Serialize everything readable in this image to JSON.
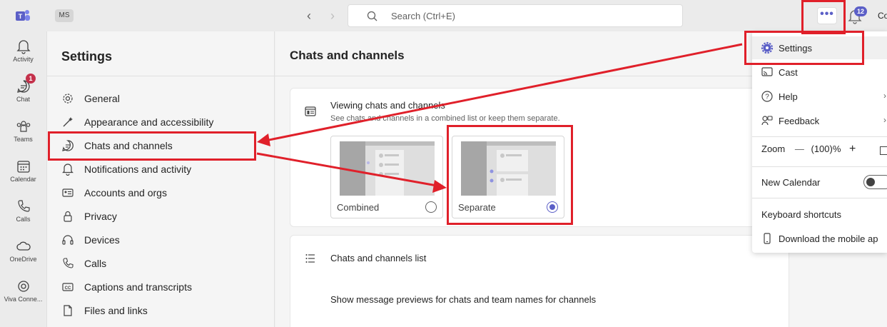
{
  "titlebar": {
    "user_initials": "MS",
    "search_placeholder": "Search (Ctrl+E)",
    "notification_count": "12",
    "profile_text": "Co",
    "more_label": "•••"
  },
  "rail": [
    {
      "label": "Activity",
      "icon": "bell-icon"
    },
    {
      "label": "Chat",
      "icon": "chat-icon",
      "badge": "1"
    },
    {
      "label": "Teams",
      "icon": "teams-icon"
    },
    {
      "label": "Calendar",
      "icon": "calendar-icon"
    },
    {
      "label": "Calls",
      "icon": "phone-icon"
    },
    {
      "label": "OneDrive",
      "icon": "cloud-icon"
    },
    {
      "label": "Viva Conne...",
      "icon": "viva-icon"
    }
  ],
  "settings": {
    "title": "Settings",
    "items": [
      {
        "label": "General",
        "icon": "gear-icon"
      },
      {
        "label": "Appearance and accessibility",
        "icon": "wand-icon"
      },
      {
        "label": "Chats and channels",
        "icon": "chat-bubble-icon"
      },
      {
        "label": "Notifications and activity",
        "icon": "bell-icon"
      },
      {
        "label": "Accounts and orgs",
        "icon": "id-card-icon"
      },
      {
        "label": "Privacy",
        "icon": "lock-icon"
      },
      {
        "label": "Devices",
        "icon": "headset-icon"
      },
      {
        "label": "Calls",
        "icon": "phone-icon"
      },
      {
        "label": "Captions and transcripts",
        "icon": "cc-icon"
      },
      {
        "label": "Files and links",
        "icon": "file-icon"
      }
    ]
  },
  "main": {
    "title": "Chats and channels",
    "viewing_card": {
      "heading": "Viewing chats and channels",
      "subtext": "See chats and channels in a combined list or keep them separate.",
      "options": [
        {
          "label": "Combined",
          "selected": false
        },
        {
          "label": "Separate",
          "selected": true
        }
      ]
    },
    "list_card": {
      "heading": "Chats and channels list",
      "preview_text": "Show message previews for chats and team names for channels"
    }
  },
  "menu": {
    "settings": "Settings",
    "cast": "Cast",
    "help": "Help",
    "feedback": "Feedback",
    "zoom_label": "Zoom",
    "zoom_minus": "—",
    "zoom_value": "(100)%",
    "zoom_plus": "+",
    "new_calendar": "New Calendar",
    "new_calendar_on": false,
    "keyboard_shortcuts": "Keyboard shortcuts",
    "download_mobile": "Download the mobile ap"
  },
  "colors": {
    "accent": "#5b5fc7",
    "annotation_red": "#e0202a",
    "badge_red": "#c4314b"
  }
}
